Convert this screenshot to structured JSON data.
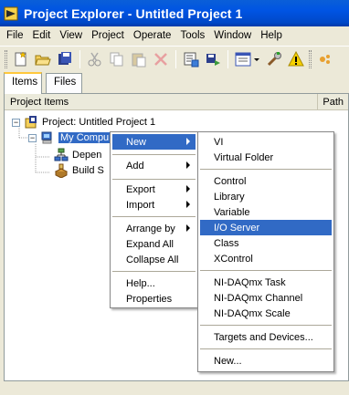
{
  "window": {
    "title": "Project Explorer - Untitled Project 1"
  },
  "menubar": [
    "File",
    "Edit",
    "View",
    "Project",
    "Operate",
    "Tools",
    "Window",
    "Help"
  ],
  "toolbar": {
    "icons": [
      "new-icon",
      "open-icon",
      "save-all-icon",
      "cut-icon",
      "copy-icon",
      "paste-icon",
      "delete-icon",
      "build-icon",
      "deploy-icon",
      "view-dropdown-icon",
      "wrench-icon",
      "warning-icon",
      "more-icon"
    ]
  },
  "tabs": [
    "Items",
    "Files"
  ],
  "columns": {
    "items": "Project Items",
    "path": "Path"
  },
  "tree": {
    "project": "Project: Untitled Project 1",
    "computer": "My Computer",
    "computer_visible": "My Compu",
    "dependencies": "Depen",
    "build": "Build S"
  },
  "context_menu": {
    "items": [
      {
        "label": "New",
        "submenu": true,
        "highlighted": true
      },
      {
        "label": "Add",
        "submenu": true
      },
      {
        "label": "Export",
        "submenu": true
      },
      {
        "label": "Import",
        "submenu": true
      },
      {
        "label": "Arrange by",
        "submenu": true
      },
      {
        "label": "Expand All"
      },
      {
        "label": "Collapse All"
      },
      {
        "label": "Help..."
      },
      {
        "label": "Properties"
      }
    ]
  },
  "new_submenu": {
    "items": [
      "VI",
      "Virtual Folder",
      "Control",
      "Library",
      "Variable",
      "I/O Server",
      "Class",
      "XControl",
      "NI-DAQmx Task",
      "NI-DAQmx Channel",
      "NI-DAQmx Scale",
      "Targets and Devices...",
      "New..."
    ],
    "highlighted": "I/O Server"
  },
  "colors": {
    "title": "#0054e3",
    "highlight": "#316ac5",
    "tab_accent": "#ffc83c"
  }
}
